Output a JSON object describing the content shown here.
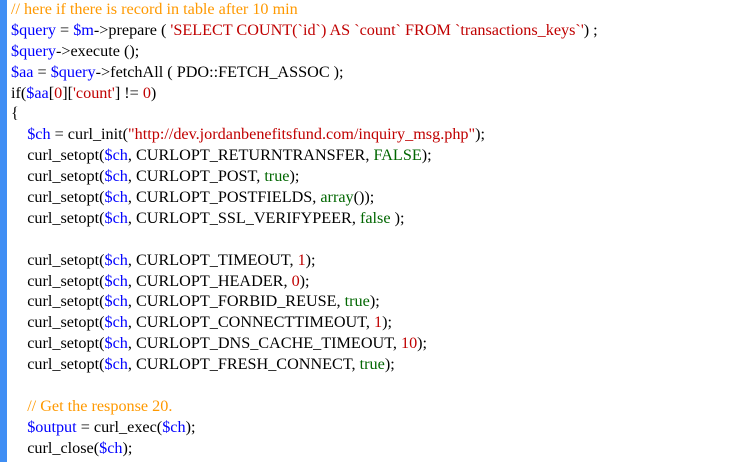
{
  "editor": {
    "colors": {
      "gutter": "#3f8ef4",
      "background": "#ffffff",
      "plain": "#000000",
      "variable": "#0000ff",
      "string": "#c00000",
      "constant": "#000000",
      "comment": "#ff9900",
      "keyword": "#0000ff",
      "number": "#c00000",
      "boolean": "#006600"
    },
    "lines": [
      [
        {
          "t": "// here if there is record in table after 10 min",
          "c": "comment"
        }
      ],
      [
        {
          "t": "$query",
          "c": "variable"
        },
        {
          "t": " = ",
          "c": "plain"
        },
        {
          "t": "$m",
          "c": "variable"
        },
        {
          "t": "->prepare ( ",
          "c": "plain"
        },
        {
          "t": "'SELECT COUNT(`id`) AS `count` FROM `transactions_keys`'",
          "c": "string"
        },
        {
          "t": ") ;",
          "c": "plain"
        }
      ],
      [
        {
          "t": "$query",
          "c": "variable"
        },
        {
          "t": "->execute ();",
          "c": "plain"
        }
      ],
      [
        {
          "t": "$aa",
          "c": "variable"
        },
        {
          "t": " = ",
          "c": "plain"
        },
        {
          "t": "$query",
          "c": "variable"
        },
        {
          "t": "->fetchAll ( PDO::FETCH_ASSOC );",
          "c": "plain"
        }
      ],
      [
        {
          "t": "if(",
          "c": "plain"
        },
        {
          "t": "$aa",
          "c": "variable"
        },
        {
          "t": "[",
          "c": "plain"
        },
        {
          "t": "0",
          "c": "number"
        },
        {
          "t": "][",
          "c": "plain"
        },
        {
          "t": "'count'",
          "c": "string"
        },
        {
          "t": "] != ",
          "c": "plain"
        },
        {
          "t": "0",
          "c": "number"
        },
        {
          "t": ")",
          "c": "plain"
        }
      ],
      [
        {
          "t": "{",
          "c": "plain"
        }
      ],
      [
        {
          "t": "    ",
          "c": "plain"
        },
        {
          "t": "$ch",
          "c": "variable"
        },
        {
          "t": " = curl_init(",
          "c": "plain"
        },
        {
          "t": "\"http://dev.jordanbenefitsfund.com/inquiry_msg.php\"",
          "c": "string"
        },
        {
          "t": ");",
          "c": "plain"
        }
      ],
      [
        {
          "t": "    curl_setopt(",
          "c": "plain"
        },
        {
          "t": "$ch",
          "c": "variable"
        },
        {
          "t": ", CURLOPT_RETURNTRANSFER, ",
          "c": "plain"
        },
        {
          "t": "FALSE",
          "c": "boolean"
        },
        {
          "t": ");",
          "c": "plain"
        }
      ],
      [
        {
          "t": "    curl_setopt(",
          "c": "plain"
        },
        {
          "t": "$ch",
          "c": "variable"
        },
        {
          "t": ", CURLOPT_POST, ",
          "c": "plain"
        },
        {
          "t": "true",
          "c": "boolean"
        },
        {
          "t": ");",
          "c": "plain"
        }
      ],
      [
        {
          "t": "    curl_setopt(",
          "c": "plain"
        },
        {
          "t": "$ch",
          "c": "variable"
        },
        {
          "t": ", CURLOPT_POSTFIELDS, ",
          "c": "plain"
        },
        {
          "t": "array",
          "c": "boolean"
        },
        {
          "t": "());",
          "c": "plain"
        }
      ],
      [
        {
          "t": "    curl_setopt(",
          "c": "plain"
        },
        {
          "t": "$ch",
          "c": "variable"
        },
        {
          "t": ", CURLOPT_SSL_VERIFYPEER, ",
          "c": "plain"
        },
        {
          "t": "false",
          "c": "boolean"
        },
        {
          "t": " );",
          "c": "plain"
        }
      ],
      [
        {
          "t": "",
          "c": "plain"
        }
      ],
      [
        {
          "t": "    curl_setopt(",
          "c": "plain"
        },
        {
          "t": "$ch",
          "c": "variable"
        },
        {
          "t": ", CURLOPT_TIMEOUT, ",
          "c": "plain"
        },
        {
          "t": "1",
          "c": "number"
        },
        {
          "t": ");",
          "c": "plain"
        }
      ],
      [
        {
          "t": "    curl_setopt(",
          "c": "plain"
        },
        {
          "t": "$ch",
          "c": "variable"
        },
        {
          "t": ", CURLOPT_HEADER, ",
          "c": "plain"
        },
        {
          "t": "0",
          "c": "number"
        },
        {
          "t": ");",
          "c": "plain"
        }
      ],
      [
        {
          "t": "    curl_setopt(",
          "c": "plain"
        },
        {
          "t": "$ch",
          "c": "variable"
        },
        {
          "t": ", CURLOPT_FORBID_REUSE, ",
          "c": "plain"
        },
        {
          "t": "true",
          "c": "boolean"
        },
        {
          "t": ");",
          "c": "plain"
        }
      ],
      [
        {
          "t": "    curl_setopt(",
          "c": "plain"
        },
        {
          "t": "$ch",
          "c": "variable"
        },
        {
          "t": ", CURLOPT_CONNECTTIMEOUT, ",
          "c": "plain"
        },
        {
          "t": "1",
          "c": "number"
        },
        {
          "t": ");",
          "c": "plain"
        }
      ],
      [
        {
          "t": "    curl_setopt(",
          "c": "plain"
        },
        {
          "t": "$ch",
          "c": "variable"
        },
        {
          "t": ", CURLOPT_DNS_CACHE_TIMEOUT, ",
          "c": "plain"
        },
        {
          "t": "10",
          "c": "number"
        },
        {
          "t": ");",
          "c": "plain"
        }
      ],
      [
        {
          "t": "    curl_setopt(",
          "c": "plain"
        },
        {
          "t": "$ch",
          "c": "variable"
        },
        {
          "t": ", CURLOPT_FRESH_CONNECT, ",
          "c": "plain"
        },
        {
          "t": "true",
          "c": "boolean"
        },
        {
          "t": ");",
          "c": "plain"
        }
      ],
      [
        {
          "t": "",
          "c": "plain"
        }
      ],
      [
        {
          "t": "    ",
          "c": "plain"
        },
        {
          "t": "// Get the response 20.",
          "c": "comment"
        }
      ],
      [
        {
          "t": "    ",
          "c": "plain"
        },
        {
          "t": "$output",
          "c": "variable"
        },
        {
          "t": " = curl_exec(",
          "c": "plain"
        },
        {
          "t": "$ch",
          "c": "variable"
        },
        {
          "t": ");",
          "c": "plain"
        }
      ],
      [
        {
          "t": "    curl_close(",
          "c": "plain"
        },
        {
          "t": "$ch",
          "c": "variable"
        },
        {
          "t": ");",
          "c": "plain"
        }
      ]
    ]
  }
}
